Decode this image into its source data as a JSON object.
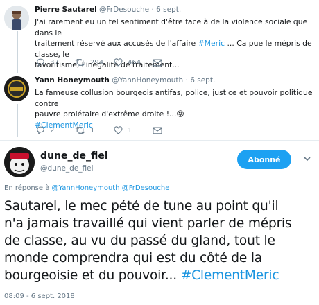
{
  "tweet1": {
    "name": "Pierre Sautarel",
    "handle": "@FrDesouche",
    "time": "· 6 sept.",
    "line1": "J'ai rarement eu un tel sentiment d'être face à de la violence sociale que dans le",
    "line2_pre": "traitement réservé aux accusés de l'affaire ",
    "line2_tag": "#Meric",
    "line2_post": " ... Ca pue le mépris de classe, le",
    "line3": "favoritisme, l'inégalité de traitement...",
    "replies": "37",
    "retweets": "294",
    "likes": "464"
  },
  "tweet2": {
    "name": "Yann Honeymouth",
    "handle": "@YannHoneymouth",
    "time": "· 6 sept.",
    "line1": "La fameuse collusion bourgeois antifas, police, justice et pouvoir politique contre",
    "line2": "pauvre prolétaire d'extrême droite !...",
    "emoji": "😜",
    "tag": "#ClementMeric",
    "replies": "2",
    "retweets": "1",
    "likes": "1"
  },
  "main": {
    "name": "dune_de_fiel",
    "handle": "@dune_de_fiel",
    "follow_label": "Abonné",
    "reply_prefix": "En réponse à ",
    "reply_user1": "@YannHoneymouth",
    "reply_user2": "@FrDesouche",
    "line1": "Sautarel, le mec pété de tune au point qu'il",
    "line2": "n'a jamais travaillé qui vient parler de mépris",
    "line3": "de classe, au vu du passé du gland, tout le",
    "line4": "monde comprendra qui est du côté de la",
    "line5_pre": "bourgeoisie et du pouvoir... ",
    "line5_tag": "#ClementMeric",
    "timestamp": "08:09 - 6 sept. 2018"
  },
  "colors": {
    "accent": "#1da1f2",
    "link": "#1b95e0",
    "muted": "#657786"
  }
}
